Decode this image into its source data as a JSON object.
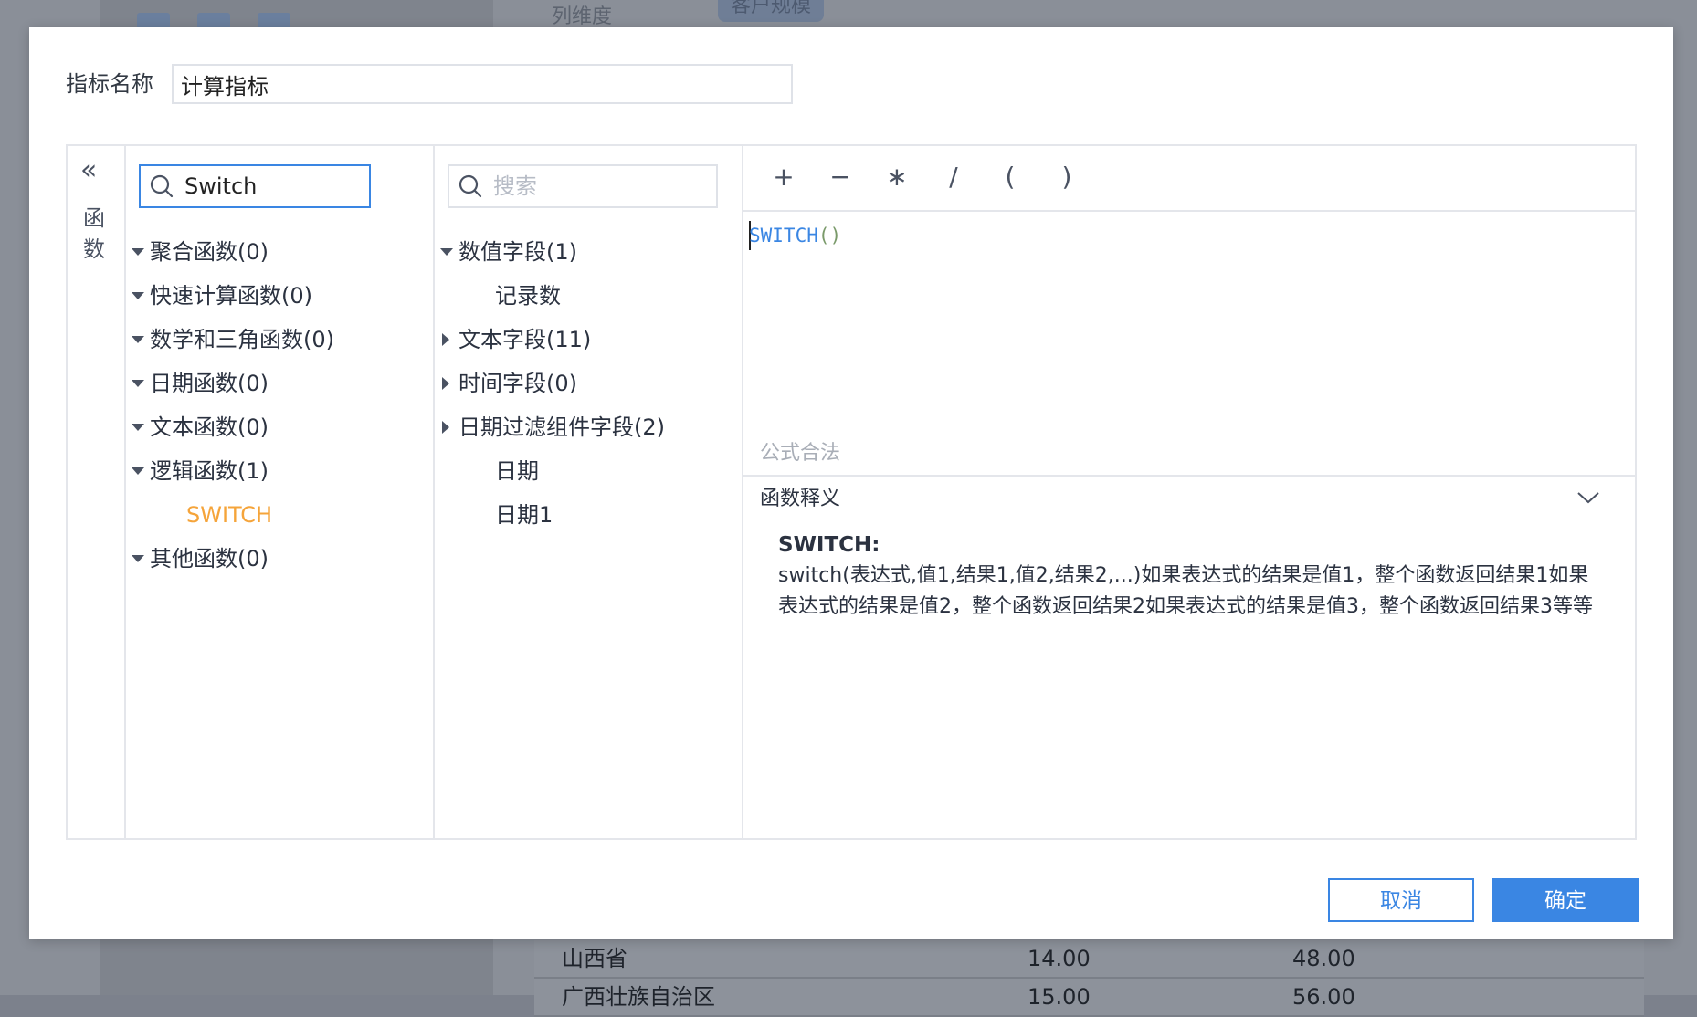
{
  "background": {
    "column_label": "列维度",
    "tag_label": "客户规模",
    "table_rows": [
      {
        "name": "山西省",
        "v1": "14.00",
        "v2": "48.00"
      },
      {
        "name": "广西壮族自治区",
        "v1": "15.00",
        "v2": "56.00"
      }
    ]
  },
  "dialog": {
    "name_label": "指标名称",
    "name_value": "计算指标",
    "collapse_icon": "double-chevron-left-icon",
    "side_tab_label": "函数",
    "func_search": {
      "value": "Switch",
      "icon": "search-icon"
    },
    "func_groups": [
      {
        "label": "聚合函数(0)",
        "expanded": true
      },
      {
        "label": "快速计算函数(0)",
        "expanded": true
      },
      {
        "label": "数学和三角函数(0)",
        "expanded": true
      },
      {
        "label": "日期函数(0)",
        "expanded": true
      },
      {
        "label": "文本函数(0)",
        "expanded": true
      },
      {
        "label": "逻辑函数(1)",
        "expanded": true
      },
      {
        "label": "其他函数(0)",
        "expanded": true
      }
    ],
    "func_selected": "SWITCH",
    "field_search": {
      "placeholder": "搜索"
    },
    "field_groups": [
      {
        "label": "数值字段(1)",
        "expanded": true
      },
      {
        "label": "记录数",
        "child": true
      },
      {
        "label": "文本字段(11)",
        "expanded": false
      },
      {
        "label": "时间字段(0)",
        "expanded": false
      },
      {
        "label": "日期过滤组件字段(2)",
        "expanded": false
      },
      {
        "label": "日期",
        "child": true
      },
      {
        "label": "日期1",
        "child": true
      }
    ],
    "operators": [
      "+",
      "−",
      "∗",
      "/",
      "(",
      ")"
    ],
    "formula": {
      "fn": "SWITCH",
      "args": "()"
    },
    "validity_text": "公式合法",
    "explain": {
      "header": "函数释义",
      "title": "SWITCH:",
      "body": "switch(表达式,值1,结果1,值2,结果2,...)如果表达式的结果是值1，整个函数返回结果1如果表达式的结果是值2，整个函数返回结果2如果表达式的结果是值3，整个函数返回结果3等等"
    },
    "cancel_label": "取消",
    "ok_label": "确定",
    "accent_color": "#3a86e3",
    "selected_color": "#f5a43a"
  }
}
